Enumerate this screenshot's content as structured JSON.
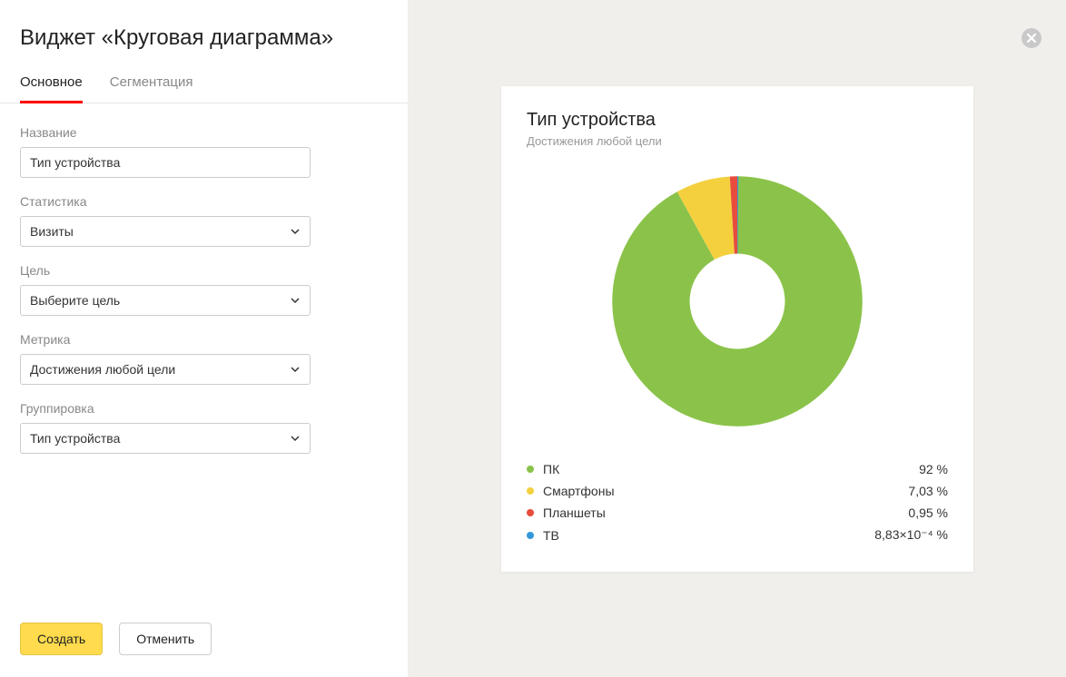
{
  "sidebar": {
    "title": "Виджет «Круговая диаграмма»",
    "tabs": [
      {
        "label": "Основное",
        "active": true
      },
      {
        "label": "Сегментация",
        "active": false
      }
    ],
    "fields": {
      "name": {
        "label": "Название",
        "value": "Тип устройства"
      },
      "statistics": {
        "label": "Статистика",
        "value": "Визиты"
      },
      "goal": {
        "label": "Цель",
        "value": "Выберите цель"
      },
      "metric": {
        "label": "Метрика",
        "value": "Достижения любой цели"
      },
      "grouping": {
        "label": "Группировка",
        "value": "Тип устройства"
      }
    },
    "actions": {
      "create": "Создать",
      "cancel": "Отменить"
    }
  },
  "preview": {
    "title": "Тип устройства",
    "subtitle": "Достижения любой цели",
    "legend": [
      {
        "label": "ПК",
        "value_display": "92 %",
        "color": "#8bc34a"
      },
      {
        "label": "Смартфоны",
        "value_display": "7,03 %",
        "color": "#f4d03f"
      },
      {
        "label": "Планшеты",
        "value_display": "0,95 %",
        "color": "#e74c3c"
      },
      {
        "label": "ТВ",
        "value_display": "8,83×10⁻⁴ %",
        "color": "#3498db"
      }
    ]
  },
  "chart_data": {
    "type": "pie",
    "title": "Тип устройства",
    "subtitle": "Достижения любой цели",
    "categories": [
      "ПК",
      "Смартфоны",
      "Планшеты",
      "ТВ"
    ],
    "values": [
      92,
      7.03,
      0.95,
      0.000883
    ],
    "unit": "%",
    "colors": [
      "#8bc34a",
      "#f4d03f",
      "#e74c3c",
      "#3498db"
    ],
    "donut_inner_radius_ratio": 0.38
  }
}
